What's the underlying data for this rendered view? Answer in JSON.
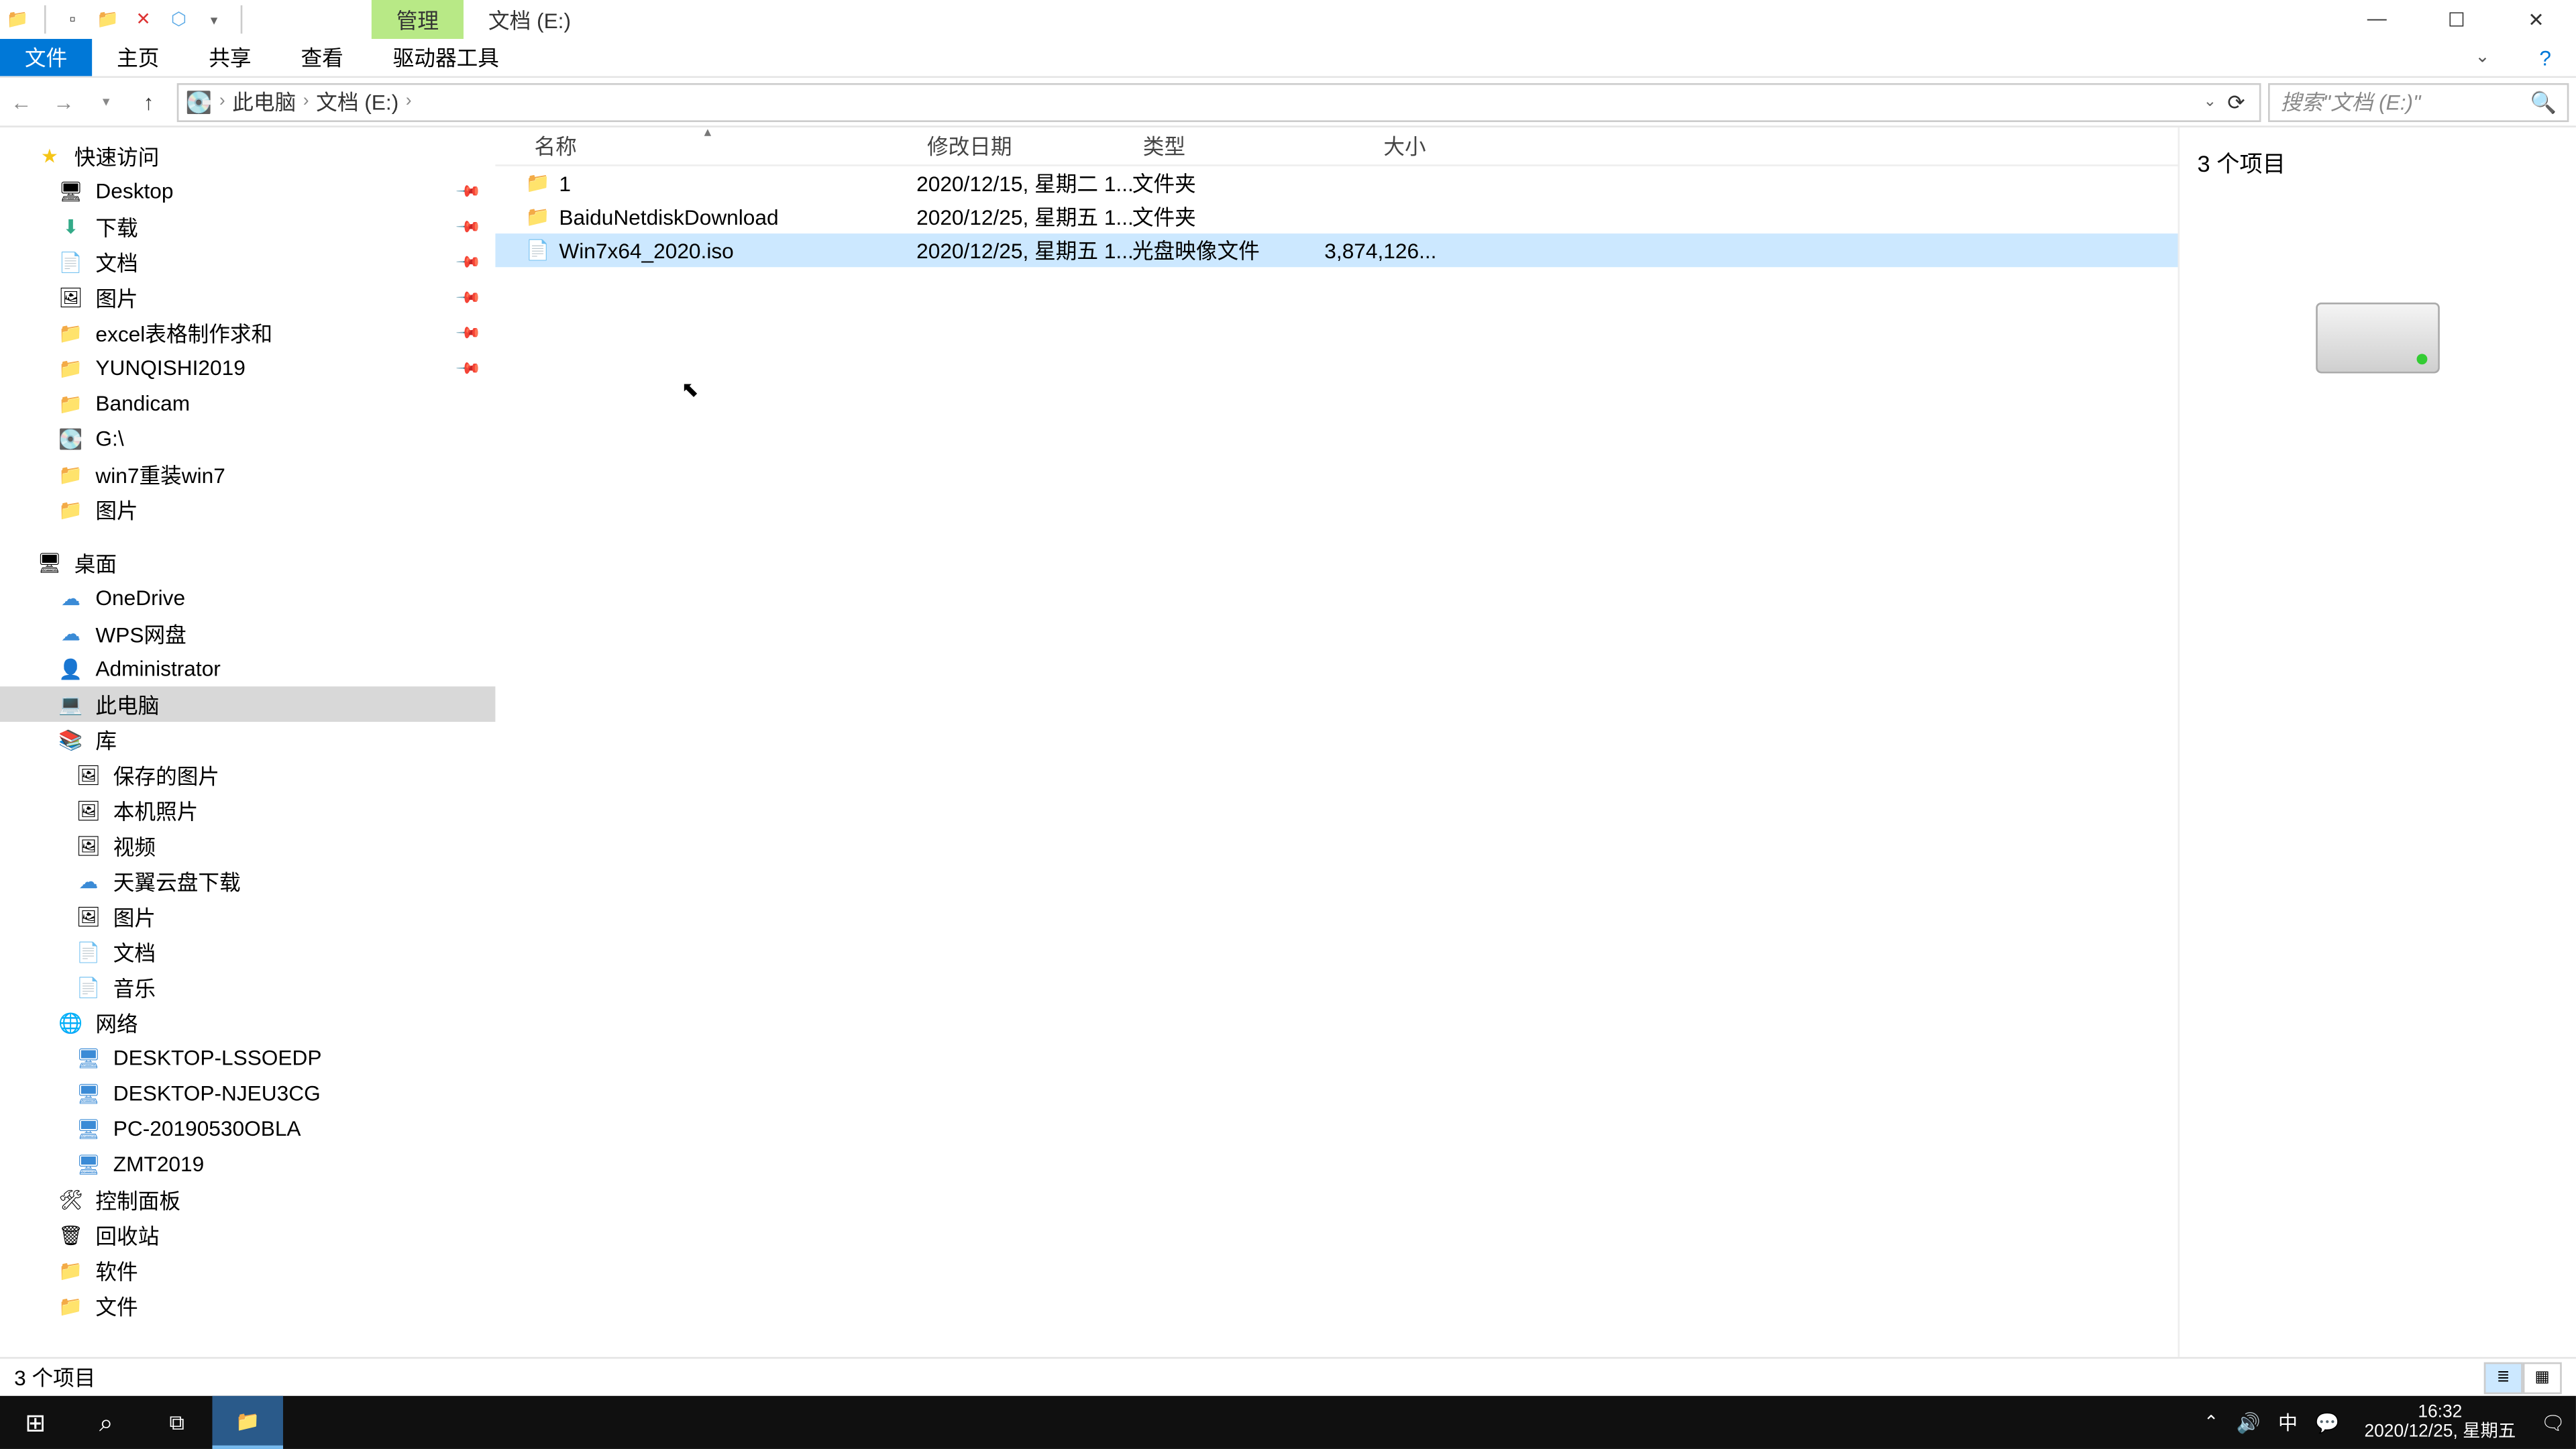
{
  "titlebar": {
    "context_tab": "管理",
    "title": "文档 (E:)"
  },
  "ribbon": {
    "file": "文件",
    "tabs": [
      "主页",
      "共享",
      "查看",
      "驱动器工具"
    ]
  },
  "address": {
    "crumbs": [
      "此电脑",
      "文档 (E:)"
    ],
    "search_placeholder": "搜索\"文档 (E:)\""
  },
  "columns": {
    "name": "名称",
    "date": "修改日期",
    "type": "类型",
    "size": "大小"
  },
  "files": [
    {
      "icon": "folder",
      "name": "1",
      "date": "2020/12/15, 星期二 1...",
      "type": "文件夹",
      "size": "",
      "selected": false
    },
    {
      "icon": "folder",
      "name": "BaiduNetdiskDownload",
      "date": "2020/12/25, 星期五 1...",
      "type": "文件夹",
      "size": "",
      "selected": false
    },
    {
      "icon": "file",
      "name": "Win7x64_2020.iso",
      "date": "2020/12/25, 星期五 1...",
      "type": "光盘映像文件",
      "size": "3,874,126...",
      "selected": true
    }
  ],
  "preview": {
    "count_label": "3 个项目"
  },
  "nav": {
    "quick_access": "快速访问",
    "pinned": [
      {
        "icon": "desktop",
        "label": "Desktop"
      },
      {
        "icon": "download",
        "label": "下载"
      },
      {
        "icon": "doc",
        "label": "文档"
      },
      {
        "icon": "pic",
        "label": "图片"
      },
      {
        "icon": "folder",
        "label": "excel表格制作求和"
      },
      {
        "icon": "folder",
        "label": "YUNQISHI2019"
      }
    ],
    "recent": [
      {
        "icon": "folder",
        "label": "Bandicam"
      },
      {
        "icon": "drive",
        "label": "G:\\"
      },
      {
        "icon": "folder",
        "label": "win7重装win7"
      },
      {
        "icon": "folder",
        "label": "图片"
      }
    ],
    "desktop_root": "桌面",
    "desktop_items": [
      {
        "icon": "cloud",
        "label": "OneDrive"
      },
      {
        "icon": "cloud",
        "label": "WPS网盘"
      },
      {
        "icon": "user",
        "label": "Administrator"
      },
      {
        "icon": "pc",
        "label": "此电脑",
        "selected": true
      },
      {
        "icon": "lib",
        "label": "库"
      }
    ],
    "lib_items": [
      {
        "icon": "pic",
        "label": "保存的图片"
      },
      {
        "icon": "pic",
        "label": "本机照片"
      },
      {
        "icon": "pic",
        "label": "视频"
      },
      {
        "icon": "cloud",
        "label": "天翼云盘下载"
      },
      {
        "icon": "pic",
        "label": "图片"
      },
      {
        "icon": "doc",
        "label": "文档"
      },
      {
        "icon": "doc",
        "label": "音乐"
      }
    ],
    "network": "网络",
    "network_items": [
      {
        "icon": "netpc",
        "label": "DESKTOP-LSSOEDP"
      },
      {
        "icon": "netpc",
        "label": "DESKTOP-NJEU3CG"
      },
      {
        "icon": "netpc",
        "label": "PC-20190530OBLA"
      },
      {
        "icon": "netpc",
        "label": "ZMT2019"
      }
    ],
    "extras": [
      {
        "icon": "panel",
        "label": "控制面板"
      },
      {
        "icon": "bin",
        "label": "回收站"
      },
      {
        "icon": "folder",
        "label": "软件"
      },
      {
        "icon": "folder",
        "label": "文件"
      }
    ]
  },
  "status": {
    "text": "3 个项目"
  },
  "taskbar": {
    "time": "16:32",
    "date": "2020/12/25, 星期五"
  }
}
